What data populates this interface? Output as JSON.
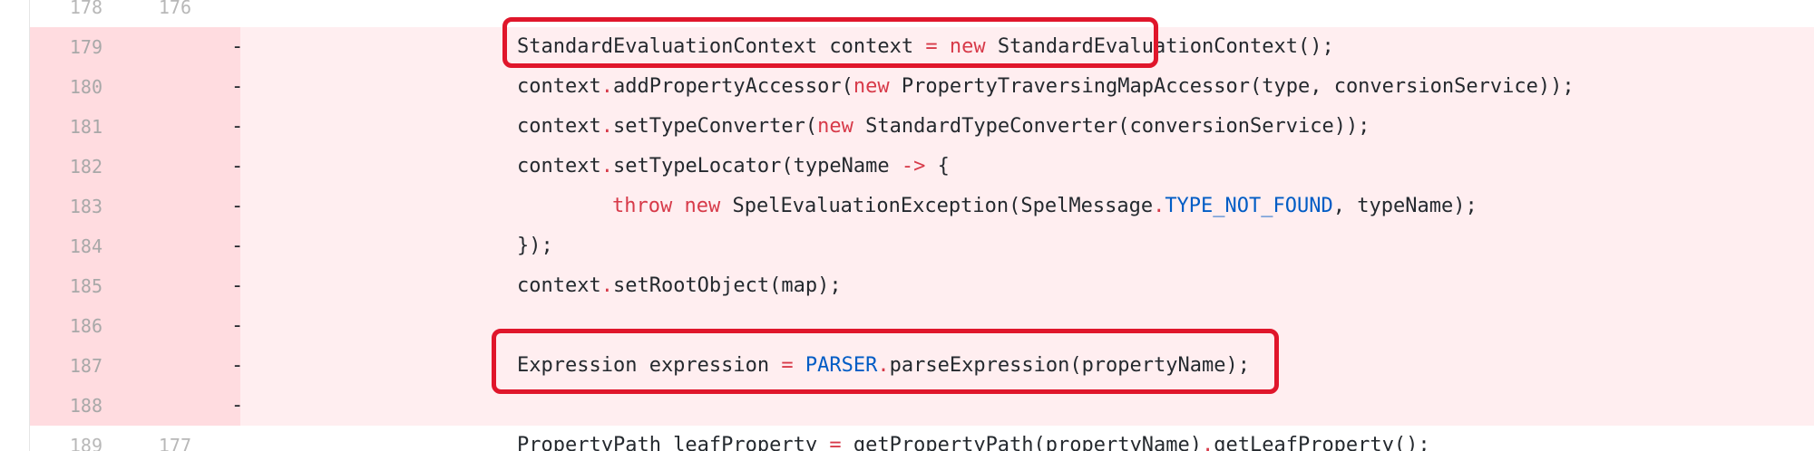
{
  "diff": {
    "rows": [
      {
        "old": "178",
        "new": "176",
        "sign": "",
        "code": ""
      },
      {
        "old": "179",
        "new": "",
        "sign": "-",
        "code_parts": [
          "StandardEvaluationContext context ",
          "=",
          " ",
          "new",
          " StandardEvaluationContext();"
        ]
      },
      {
        "old": "180",
        "new": "",
        "sign": "-",
        "code_parts": [
          "context",
          ".",
          "addPropertyAccessor(",
          "new",
          " PropertyTraversingMapAccessor(type, conversionService));"
        ]
      },
      {
        "old": "181",
        "new": "",
        "sign": "-",
        "code_parts": [
          "context",
          ".",
          "setTypeConverter(",
          "new",
          " StandardTypeConverter(conversionService));"
        ]
      },
      {
        "old": "182",
        "new": "",
        "sign": "-",
        "code_parts": [
          "context",
          ".",
          "setTypeLocator(typeName ",
          "->",
          " {"
        ]
      },
      {
        "old": "183",
        "new": "",
        "sign": "-",
        "code_parts": [
          "throw",
          " ",
          "new",
          " SpelEvaluationException(SpelMessage",
          ".",
          "TYPE_NOT_FOUND",
          ", typeName);"
        ]
      },
      {
        "old": "184",
        "new": "",
        "sign": "-",
        "code_parts": [
          "});"
        ]
      },
      {
        "old": "185",
        "new": "",
        "sign": "-",
        "code_parts": [
          "context",
          ".",
          "setRootObject(map);"
        ]
      },
      {
        "old": "186",
        "new": "",
        "sign": "-",
        "code_parts": [
          ""
        ]
      },
      {
        "old": "187",
        "new": "",
        "sign": "-",
        "code_parts": [
          "Expression expression ",
          "=",
          " ",
          "PARSER",
          ".",
          "parseExpression(propertyName);"
        ]
      },
      {
        "old": "188",
        "new": "",
        "sign": "-",
        "code_parts": [
          ""
        ]
      },
      {
        "old": "189",
        "new": "177",
        "sign": "",
        "code_parts": [
          "PropertyPath leafProperty ",
          "=",
          " getPropertyPath(propertyName)",
          ".",
          "getLeafProperty();"
        ]
      }
    ]
  },
  "colors": {
    "deleted_row_bg": "#ffeef0",
    "deleted_gutter_bg": "#ffdce0",
    "keyword": "#d73a49",
    "constant": "#005cc5",
    "highlight_border": "#e0162b"
  }
}
